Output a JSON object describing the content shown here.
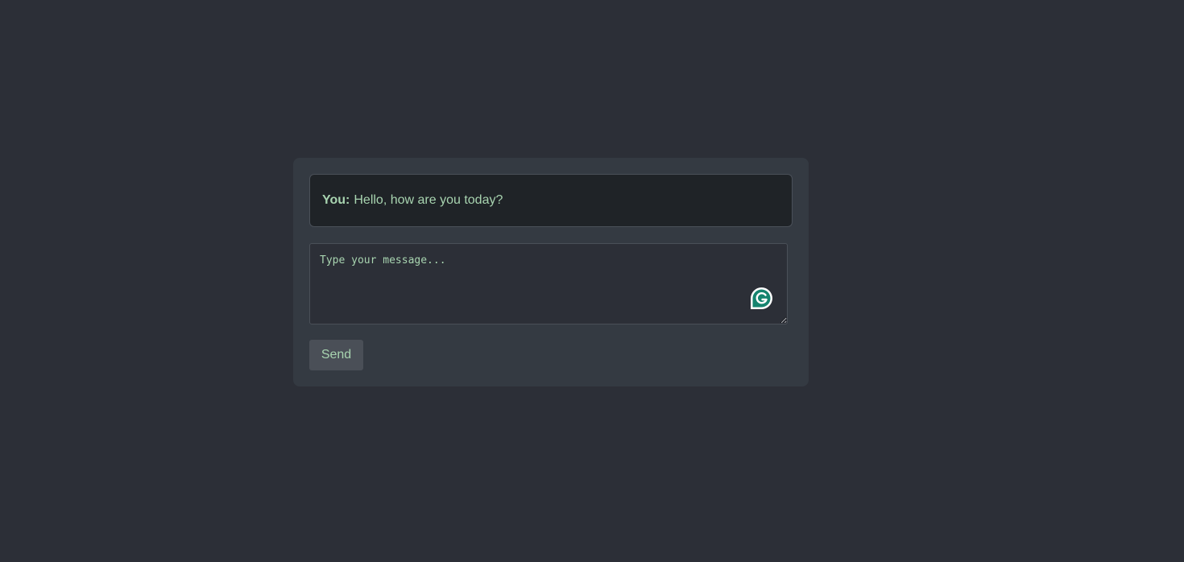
{
  "conversation": {
    "messages": [
      {
        "sender": "You:",
        "text": "Hello, how are you today?"
      }
    ]
  },
  "composer": {
    "placeholder": "Type your message...",
    "value": "",
    "assistant_icon": "grammarly-icon"
  },
  "actions": {
    "send_label": "Send"
  },
  "colors": {
    "page_background": "#2c2f37",
    "card_background": "#343a42",
    "message_background": "#1f2327",
    "text_accent": "#a8d4b0",
    "button_background": "#4a4f57",
    "grammarly_green": "#15846f"
  }
}
